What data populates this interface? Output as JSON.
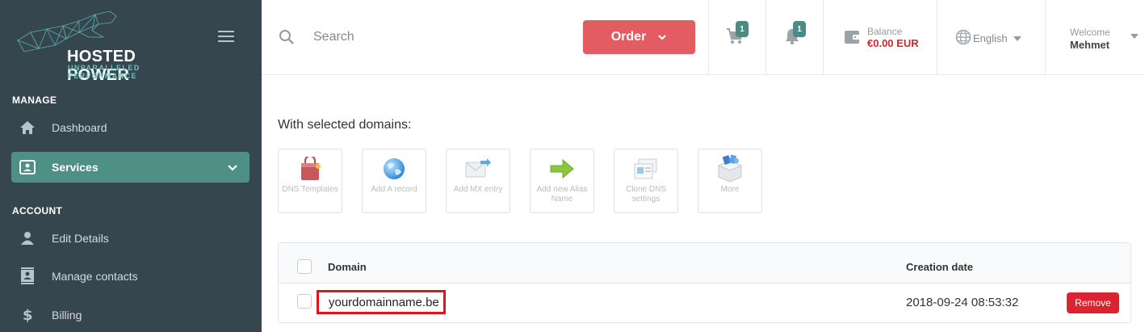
{
  "brand": {
    "title": "HOSTED POWER",
    "subtitle": "UNPARALLELED PERFORMANCE"
  },
  "sidebar": {
    "sections": [
      {
        "title": "MANAGE",
        "items": [
          {
            "label": "Dashboard",
            "icon": "home-icon",
            "active": false
          },
          {
            "label": "Services",
            "icon": "id-card-icon",
            "active": true
          }
        ]
      },
      {
        "title": "ACCOUNT",
        "items": [
          {
            "label": "Edit Details",
            "icon": "user-icon",
            "active": false
          },
          {
            "label": "Manage contacts",
            "icon": "contacts-icon",
            "active": false
          },
          {
            "label": "Billing",
            "icon": "dollar-icon",
            "active": false
          }
        ]
      }
    ]
  },
  "header": {
    "search_placeholder": "Search",
    "order_label": "Order",
    "cart_count": "1",
    "notification_count": "1",
    "balance_label": "Balance",
    "balance_value": "€0.00 EUR",
    "language": "English",
    "welcome_label": "Welcome",
    "user_name": "Mehmet"
  },
  "main": {
    "with_selected_label": "With selected domains:",
    "tools": [
      {
        "label": "DNS Templates",
        "icon": "shopping-bag-icon"
      },
      {
        "label": "Add A record",
        "icon": "globe-icon"
      },
      {
        "label": "Add MX entry",
        "icon": "mail-forward-icon"
      },
      {
        "label": "Add new Alias Name",
        "icon": "arrow-right-icon"
      },
      {
        "label": "Clone DNS settings",
        "icon": "clone-icon"
      },
      {
        "label": "More",
        "icon": "box-icon"
      }
    ],
    "table": {
      "columns": [
        "Domain",
        "Creation date"
      ],
      "rows": [
        {
          "domain": "yourdomainname.be",
          "created": "2018-09-24 08:53:32",
          "action": "Remove"
        }
      ]
    }
  },
  "colors": {
    "sidebar_bg": "#36464f",
    "accent_teal": "#4e8f86",
    "order_red": "#e35c62",
    "remove_red": "#dc2430",
    "highlight_red": "#e0141c"
  }
}
